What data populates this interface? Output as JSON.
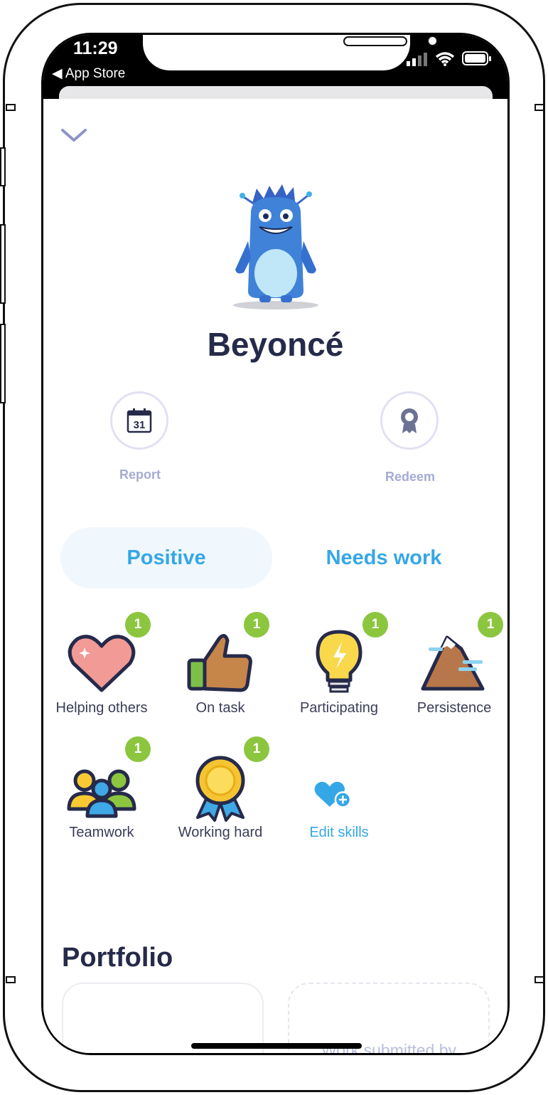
{
  "status_bar": {
    "time": "11:29",
    "back_app": "◀ App Store"
  },
  "student": {
    "name": "Beyoncé"
  },
  "actions": {
    "report_label": "Report",
    "report_calendar_day": "31",
    "redeem_label": "Redeem"
  },
  "tabs": {
    "positive": "Positive",
    "needs_work": "Needs work",
    "selected": "Positive"
  },
  "skills": [
    {
      "label": "Helping others",
      "count": "1",
      "icon": "heart-icon"
    },
    {
      "label": "On task",
      "count": "1",
      "icon": "thumbs-up-icon"
    },
    {
      "label": "Participating",
      "count": "1",
      "icon": "lightbulb-icon"
    },
    {
      "label": "Persistence",
      "count": "1",
      "icon": "mountain-icon"
    },
    {
      "label": "Teamwork",
      "count": "1",
      "icon": "people-icon"
    },
    {
      "label": "Working hard",
      "count": "1",
      "icon": "medal-icon"
    },
    {
      "label": "Edit skills",
      "icon": "heart-plus-icon"
    }
  ],
  "portfolio": {
    "title": "Portfolio",
    "empty_card_text": "Work submitted by"
  },
  "colors": {
    "accent": "#35a7e6",
    "badge": "#8cc63f",
    "heading": "#262a4a",
    "muted": "#a5abd4",
    "tab_selected_bg": "#f0f7fd"
  }
}
